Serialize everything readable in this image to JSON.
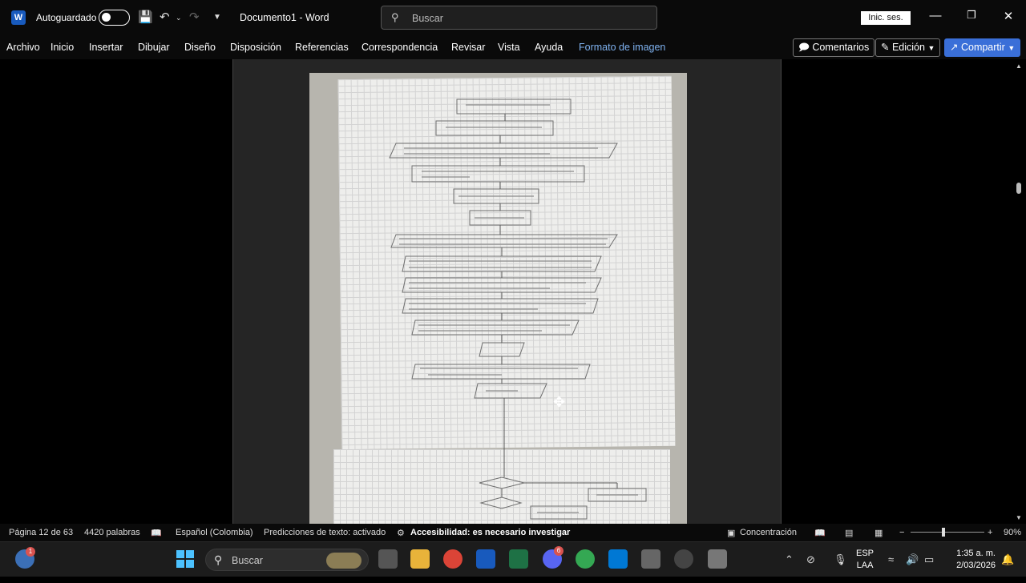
{
  "titlebar": {
    "autosave_label": "Autoguardado",
    "document_title": "Documento1  -  Word",
    "search_placeholder": "Buscar",
    "signin_label": "Inic. ses."
  },
  "ribbon": {
    "tabs": [
      "Archivo",
      "Inicio",
      "Insertar",
      "Dibujar",
      "Diseño",
      "Disposición",
      "Referencias",
      "Correspondencia",
      "Revisar",
      "Vista",
      "Ayuda",
      "Formato de imagen"
    ],
    "comments_label": "Comentarios",
    "editing_label": "Edición",
    "share_label": "Compartir"
  },
  "statusbar": {
    "page_info": "Página 12 de 63",
    "word_count": "4420 palabras",
    "language": "Español (Colombia)",
    "predictions": "Predicciones de texto: activado",
    "accessibility": "Accesibilidad: es necesario investigar",
    "focus": "Concentración",
    "zoom": "90%"
  },
  "taskbar": {
    "search_placeholder": "Buscar",
    "lang_line1": "ESP",
    "lang_line2": "LAA",
    "time": "1:35 a. m.",
    "date": "2/03/2026",
    "weather_badge": "1",
    "discord_badge": "6"
  },
  "colors": {
    "accent": "#7fb2f0",
    "share": "#3a6fd8",
    "word_blue": "#185abd"
  }
}
